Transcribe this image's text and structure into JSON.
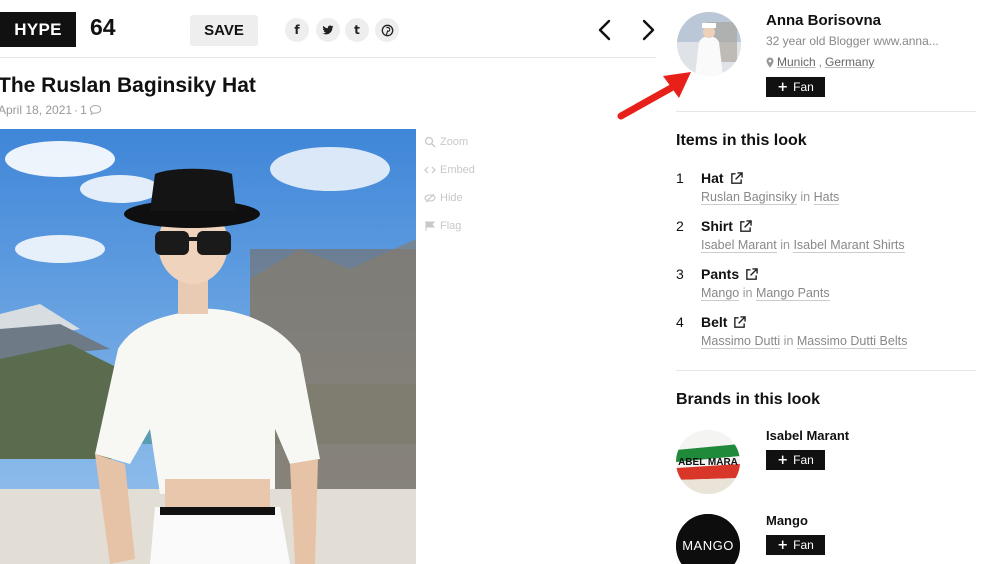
{
  "header": {
    "hype_label": "HYPE",
    "hype_count": "64",
    "save_label": "SAVE",
    "share_icons": [
      {
        "name": "facebook-icon",
        "glyph": "f"
      },
      {
        "name": "twitter-icon",
        "glyph": "t"
      },
      {
        "name": "tumblr-icon",
        "glyph": "t"
      },
      {
        "name": "pinterest-icon",
        "glyph": "p"
      }
    ]
  },
  "look": {
    "title": "The Ruslan Baginsiky Hat",
    "date": "April 18, 2021",
    "separator": "·",
    "comment_count": "1"
  },
  "tools": [
    {
      "label": "Zoom",
      "icon": "zoom-icon"
    },
    {
      "label": "Embed",
      "icon": "embed-icon"
    },
    {
      "label": "Hide",
      "icon": "hide-icon"
    },
    {
      "label": "Flag",
      "icon": "flag-icon"
    }
  ],
  "user": {
    "name": "Anna Borisovna",
    "bio": "32 year old Blogger www.anna...",
    "city": "Munich",
    "country": "Germany",
    "fan_label": "Fan"
  },
  "items_section": {
    "title": "Items in this look",
    "items": [
      {
        "num": "1",
        "name": "Hat",
        "brand": "Ruslan Baginsiky",
        "in": "in",
        "category": "Hats"
      },
      {
        "num": "2",
        "name": "Shirt",
        "brand": "Isabel Marant",
        "in": "in",
        "category": "Isabel Marant Shirts"
      },
      {
        "num": "3",
        "name": "Pants",
        "brand": "Mango",
        "in": "in",
        "category": "Mango Pants"
      },
      {
        "num": "4",
        "name": "Belt",
        "brand": "Massimo Dutti",
        "in": "in",
        "category": "Massimo Dutti Belts"
      }
    ]
  },
  "brands_section": {
    "title": "Brands in this look",
    "brands": [
      {
        "name": "Isabel Marant",
        "logo_text": "ABEL MARA",
        "fan_label": "Fan"
      },
      {
        "name": "Mango",
        "logo_text": "MANGO",
        "fan_label": "Fan"
      }
    ]
  },
  "colors": {
    "accent_arrow": "#e8201a",
    "button_dark": "#111111"
  }
}
